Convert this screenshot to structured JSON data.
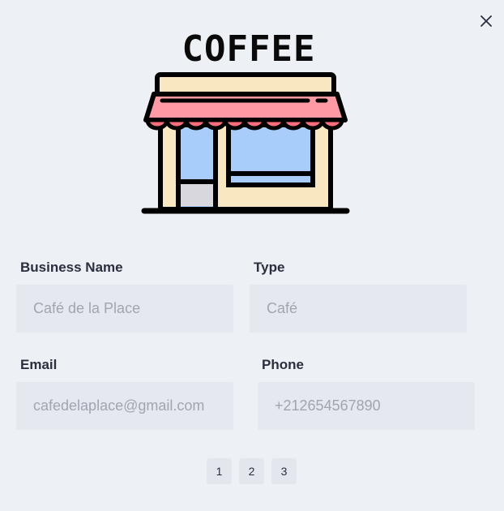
{
  "logo": {
    "text": "COFFEE"
  },
  "form": {
    "business_name": {
      "label": "Business Name",
      "placeholder": "Café de la Place"
    },
    "type": {
      "label": "Type",
      "placeholder": "Café"
    },
    "email": {
      "label": "Email",
      "placeholder": "cafedelaplace@gmail.com"
    },
    "phone": {
      "label": "Phone",
      "placeholder": "+212654567890"
    }
  },
  "pagination": {
    "pages": [
      "1",
      "2",
      "3"
    ]
  },
  "icons": {
    "close": "close-icon",
    "shop": "coffee-shop-icon"
  }
}
